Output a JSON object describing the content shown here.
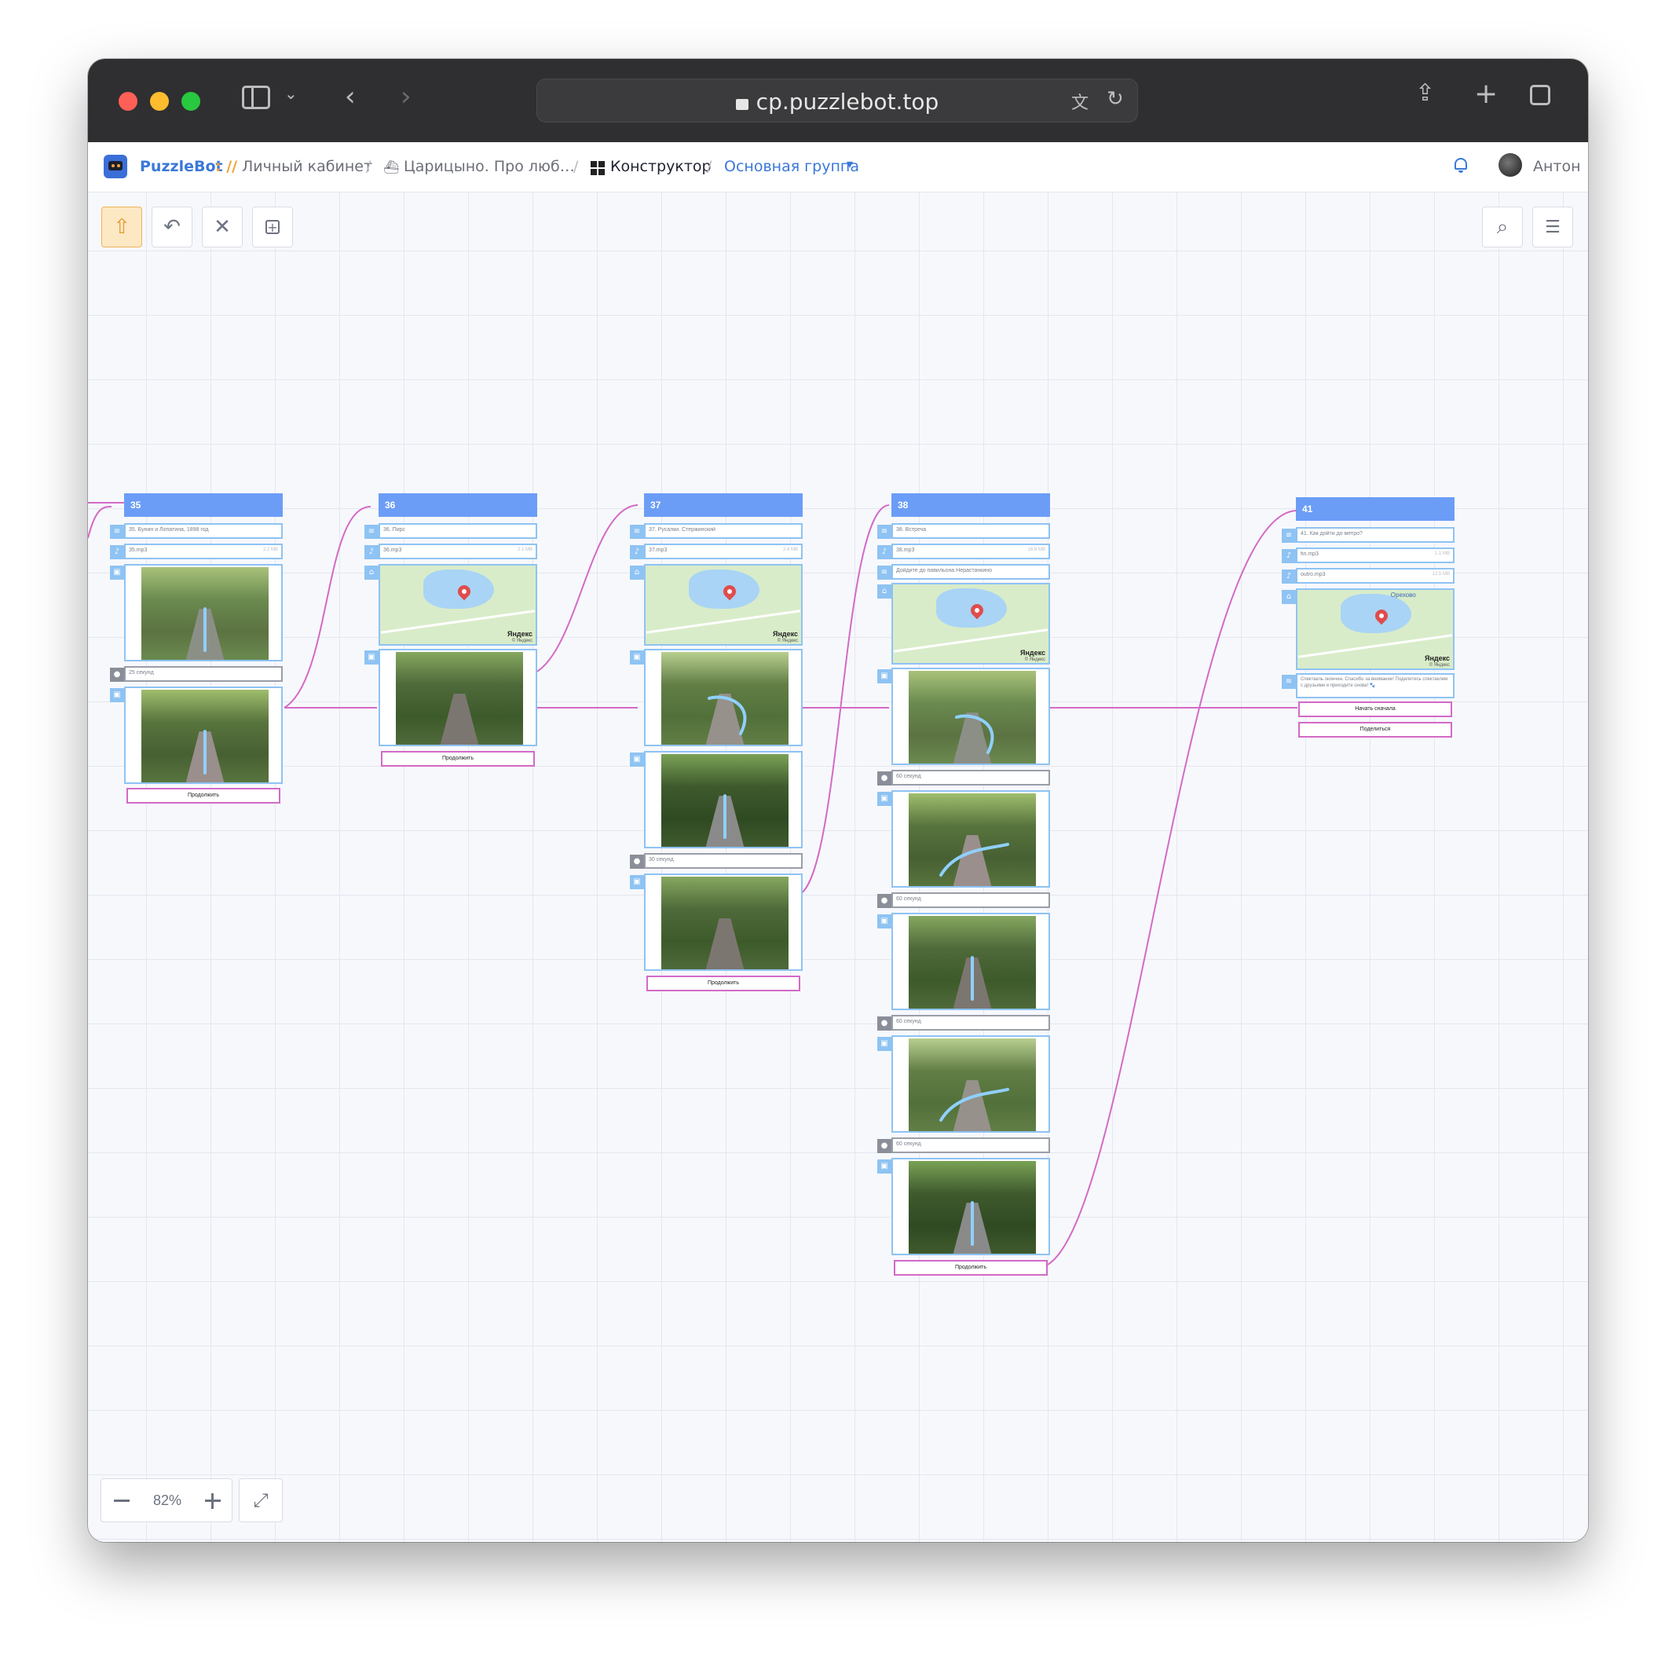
{
  "browser": {
    "url": "cp.puzzlebot.top"
  },
  "header": {
    "brand": "PuzzleBot",
    "brand_sep": ": //",
    "crumbs": [
      "Личный кабинет",
      "Царицыно. Про люб…",
      "Конструктор",
      "Основная группа"
    ],
    "user_name": "Антон"
  },
  "toolbar": {
    "zoom_level": "82%"
  },
  "colors": {
    "accent_blue": "#6b9df7",
    "block_border": "#8ec3f3",
    "button_border": "#d36ac6",
    "edge": "#d36ac6",
    "active_tool": "#f0b25a"
  },
  "nodes": [
    {
      "id": "35",
      "title": "35",
      "text": "35. Бунин и Лопатина, 1898 год",
      "audio_name": "35.mp3",
      "audio_size": "2.2 MB",
      "timer": "25 секунд",
      "button": "Продолжить"
    },
    {
      "id": "36",
      "title": "36",
      "text": "36. Пирс",
      "audio_name": "36.mp3",
      "audio_size": "2.1 MB",
      "button": "Продолжить"
    },
    {
      "id": "37",
      "title": "37",
      "text": "37. Русалки. Стержинский",
      "audio_name": "37.mp3",
      "audio_size": "2.4 MB",
      "timer": "30 секунд",
      "button": "Продолжить"
    },
    {
      "id": "38",
      "title": "38",
      "text": "38. Встреча",
      "audio_name": "38.mp3",
      "audio_size": "16.8 MB",
      "text2": "Дойдите до павильона Нерастанкино",
      "timers": [
        "60 секунд",
        "60 секунд",
        "60 секунд",
        "60 секунд"
      ],
      "button": "Продолжить"
    },
    {
      "id": "41",
      "title": "41",
      "text": "41. Как дойти до метро?",
      "audio_name": "fin.mp3",
      "audio_size": "1.1 MB",
      "audio2_name": "outro.mp3",
      "audio2_size": "12.5 MB",
      "final_text": "Спектакль окончен. Спасибо за внимание! Поделитесь спектаклем с друзьями и приходите снова! 🐾",
      "buttons": [
        "Начать сначала",
        "Поделиться"
      ]
    }
  ],
  "map_labels": {
    "yandex": "Яндекс",
    "yandex_copy": "© Яндекс",
    "orekhovo": "Орехово"
  }
}
